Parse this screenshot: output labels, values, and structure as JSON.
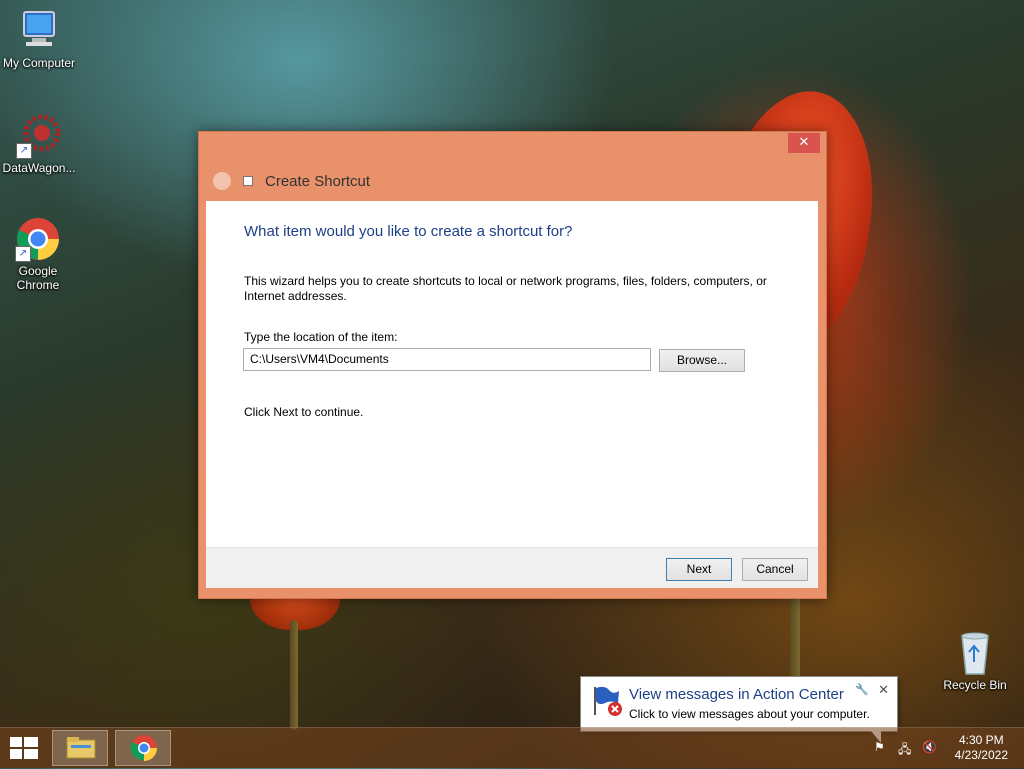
{
  "desktop": {
    "icons": [
      {
        "label": "My Computer"
      },
      {
        "label": "DataWagon..."
      },
      {
        "label": "Google Chrome"
      },
      {
        "label": "Recycle Bin"
      }
    ]
  },
  "dialog": {
    "title": "Create Shortcut",
    "close": "✕",
    "heading": "What item would you like to create a shortcut for?",
    "description": "This wizard helps you to create shortcuts to local or network programs, files, folders, computers, or Internet addresses.",
    "location_label": "Type the location of the item:",
    "location_value": "C:\\Users\\VM4\\Documents",
    "browse_label": "Browse...",
    "continue_text": "Click Next to continue.",
    "next_label": "Next",
    "cancel_label": "Cancel"
  },
  "notification": {
    "title": "View messages in Action Center",
    "text": "Click to view messages about your computer.",
    "close": "✕"
  },
  "taskbar": {
    "time": "4:30 PM",
    "date": "4/23/2022"
  },
  "colors": {
    "dialog_frame": "#e8916a",
    "heading": "#1e3f88",
    "close_button": "#d9534f"
  }
}
